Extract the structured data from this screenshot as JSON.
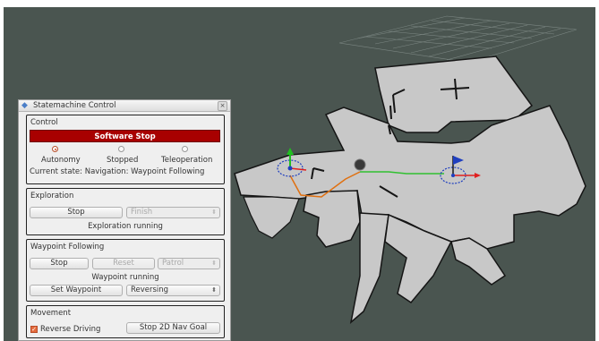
{
  "window": {
    "title": "Statemachine Control",
    "close_glyph": "×",
    "app_icon": "diamond-icon"
  },
  "control": {
    "title": "Control",
    "software_stop_label": "Software Stop",
    "modes": [
      {
        "label": "Autonomy",
        "checked": true
      },
      {
        "label": "Stopped",
        "checked": false
      },
      {
        "label": "Teleoperation",
        "checked": false
      }
    ],
    "current_state": "Current state: Navigation: Waypoint Following"
  },
  "exploration": {
    "title": "Exploration",
    "stop_label": "Stop",
    "finish_value": "Finish",
    "status": "Exploration running"
  },
  "waypoint": {
    "title": "Waypoint Following",
    "stop_label": "Stop",
    "reset_label": "Reset",
    "patrol_value": "Patrol",
    "status": "Waypoint running",
    "set_waypoint_label": "Set Waypoint",
    "mode_value": "Reversing"
  },
  "movement": {
    "title": "Movement",
    "reverse_driving_label": "Reverse Driving",
    "reverse_driving_checked": true,
    "stop_nav_goal_label": "Stop 2D Nav Goal"
  },
  "colors": {
    "viewport_background": "#4a5550",
    "map_free": "#c8c8c8",
    "map_obstacle": "#1a1a1a",
    "path_orange": "#e07010",
    "path_green": "#30c030",
    "goal_arrow": "#e02020",
    "flag_blue": "#1f3fbf",
    "software_stop_red": "#a80000"
  }
}
